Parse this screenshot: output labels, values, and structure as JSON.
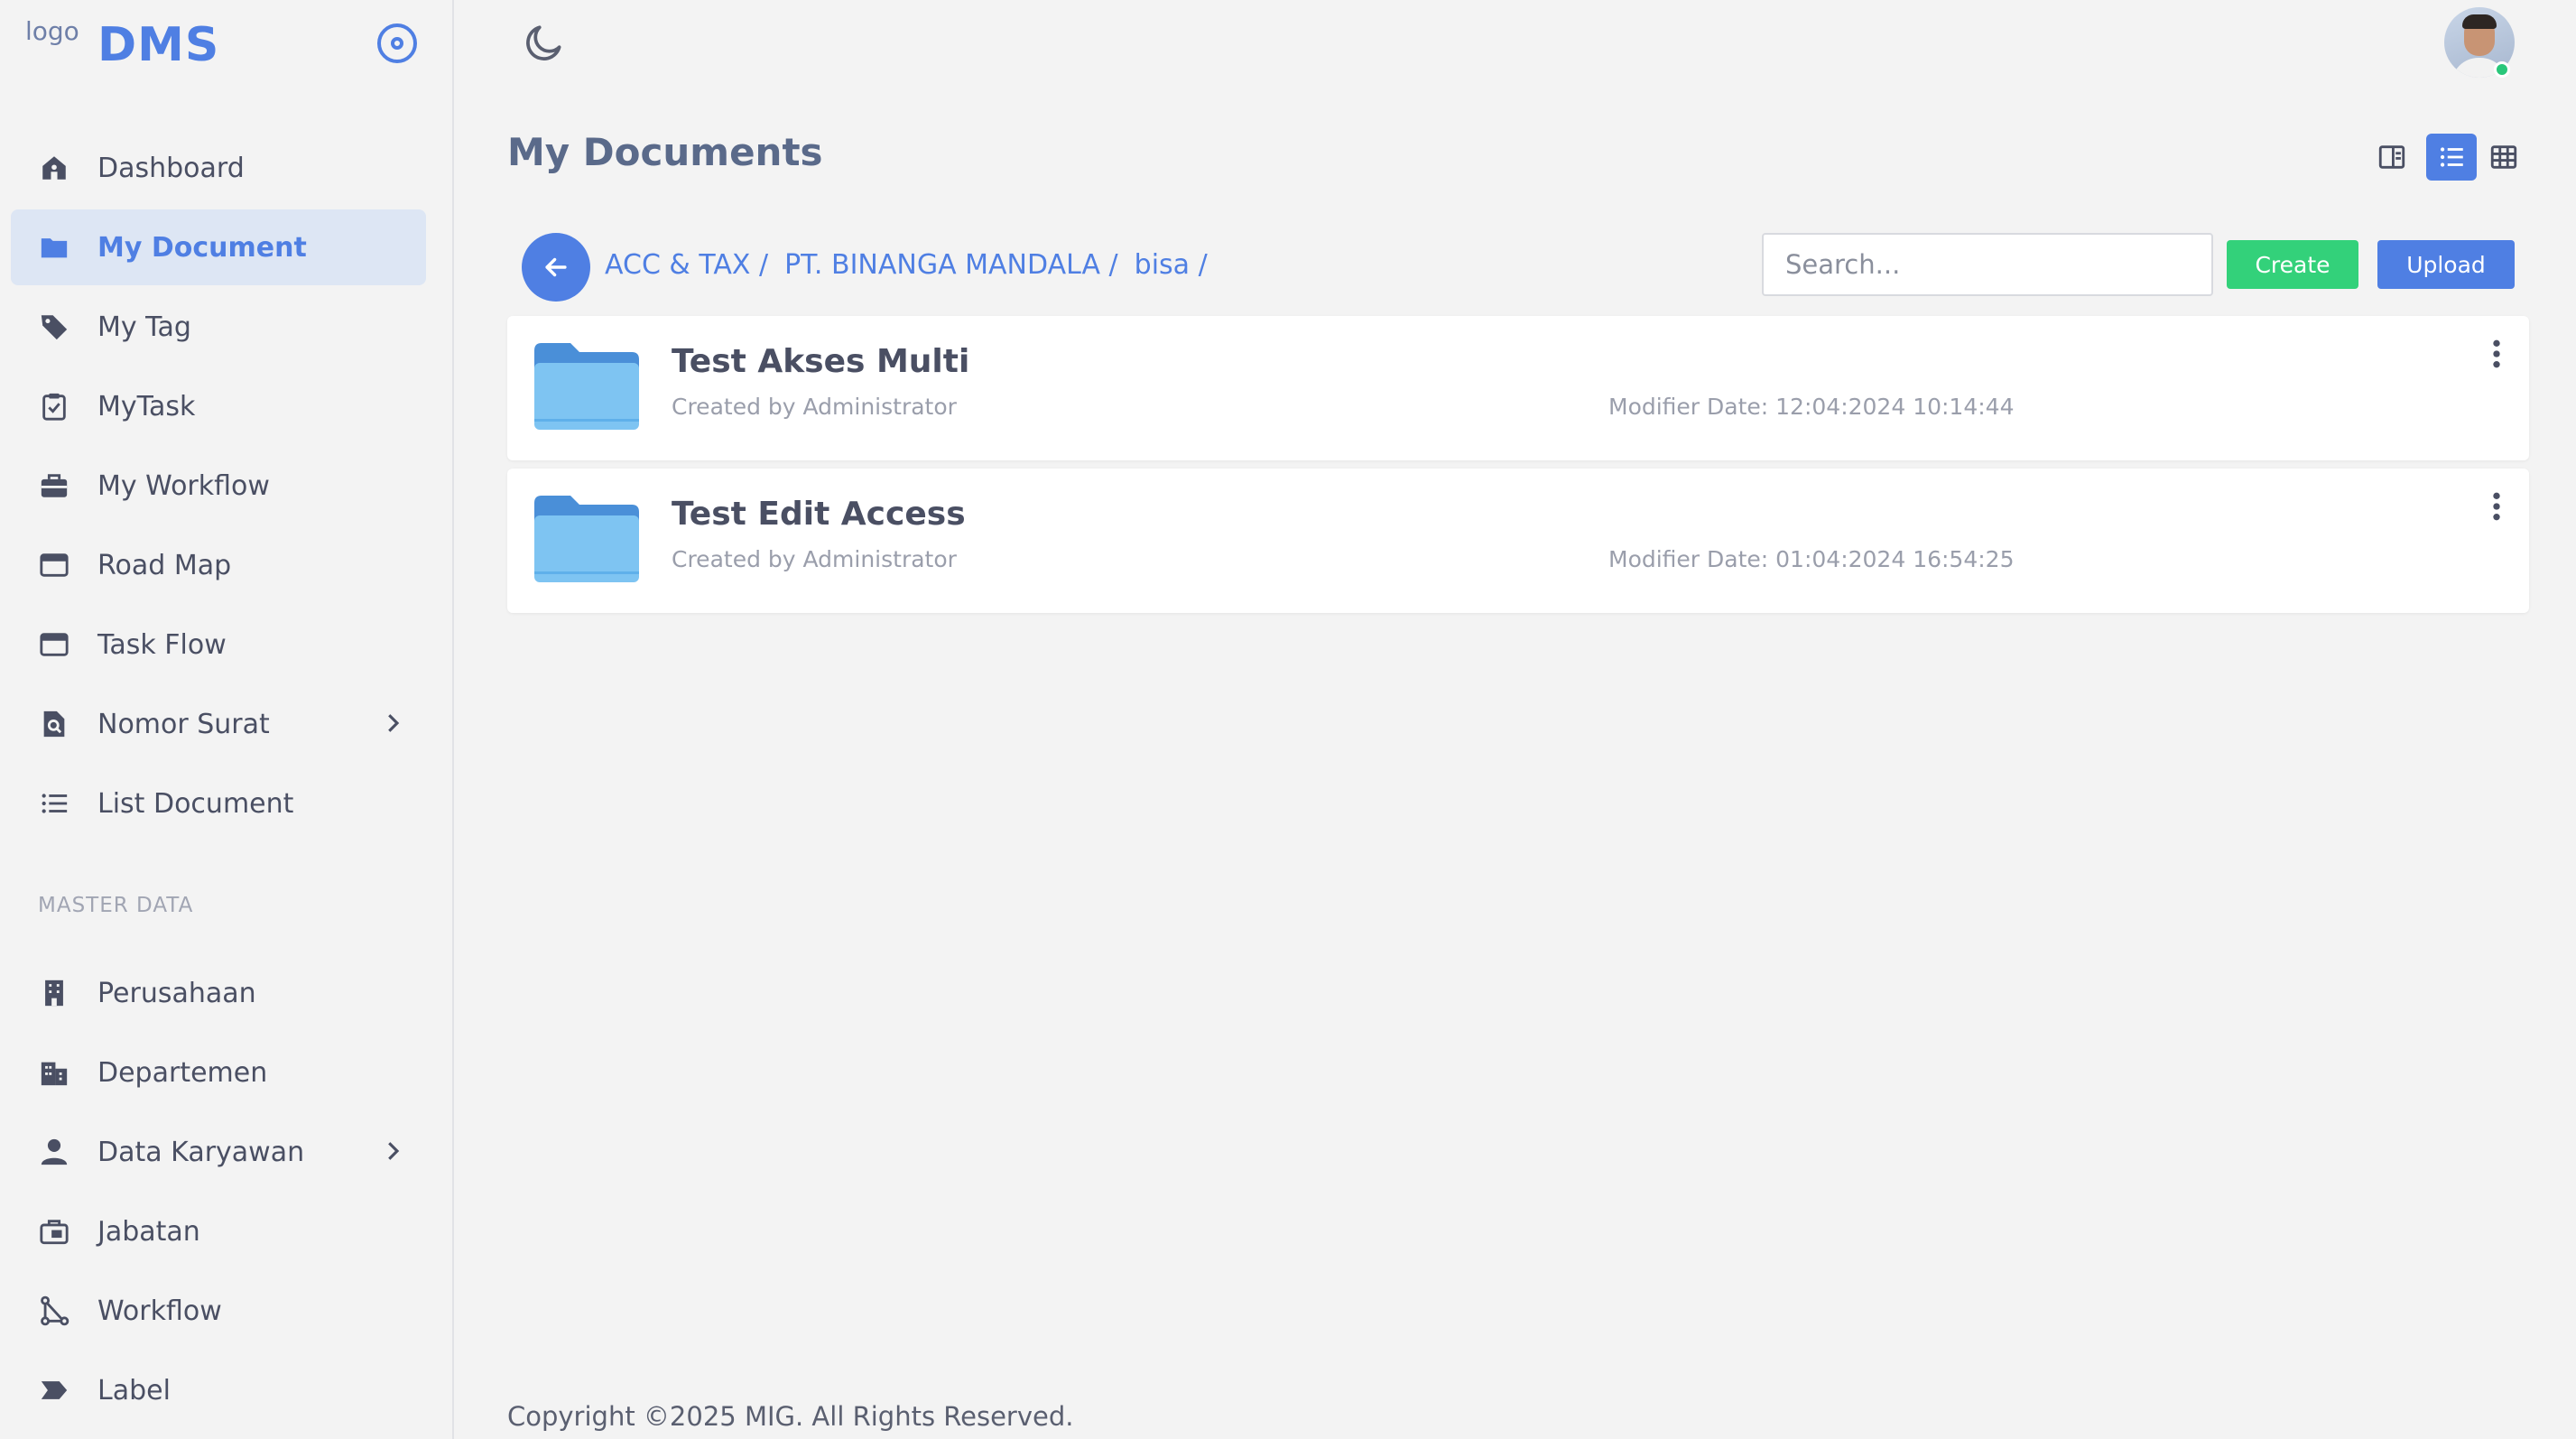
{
  "app": {
    "logo_alt": "logo",
    "brand": "DMS"
  },
  "sidebar": {
    "items": [
      {
        "label": "Dashboard",
        "icon": "home-icon",
        "active": false
      },
      {
        "label": "My Document",
        "icon": "folder-icon",
        "active": true
      },
      {
        "label": "My Tag",
        "icon": "tag-icon",
        "active": false
      },
      {
        "label": "MyTask",
        "icon": "clipboard-check-icon",
        "active": false
      },
      {
        "label": "My Workflow",
        "icon": "briefcase-icon",
        "active": false
      },
      {
        "label": "Road Map",
        "icon": "window-icon",
        "active": false
      },
      {
        "label": "Task Flow",
        "icon": "window-icon",
        "active": false
      },
      {
        "label": "Nomor Surat",
        "icon": "document-search-icon",
        "active": false,
        "has_children": true
      },
      {
        "label": "List Document",
        "icon": "list-icon",
        "active": false
      }
    ],
    "section_label": "MASTER DATA",
    "master_items": [
      {
        "label": "Perusahaan",
        "icon": "building-icon"
      },
      {
        "label": "Departemen",
        "icon": "buildings-icon"
      },
      {
        "label": "Data Karyawan",
        "icon": "person-icon",
        "has_children": true
      },
      {
        "label": "Jabatan",
        "icon": "briefcase-outline-icon"
      },
      {
        "label": "Workflow",
        "icon": "flow-icon"
      },
      {
        "label": "Label",
        "icon": "label-icon"
      }
    ]
  },
  "main": {
    "title": "My Documents",
    "breadcrumb": [
      "ACC & TAX /",
      "PT. BINANGA MANDALA /",
      "bisa /"
    ],
    "search_placeholder": "Search...",
    "create_label": "Create",
    "upload_label": "Upload",
    "active_view": "list",
    "documents": [
      {
        "name": "Test Akses Multi",
        "creator": "Created by Administrator",
        "modified": "Modifier Date: 12:04:2024 10:14:44"
      },
      {
        "name": "Test Edit Access",
        "creator": "Created by Administrator",
        "modified": "Modifier Date: 01:04:2024 16:54:25"
      }
    ]
  },
  "footer": {
    "text": "Copyright ©2025 MIG. All Rights Reserved."
  },
  "colors": {
    "accent": "#4f7fe3",
    "create": "#33d17a",
    "active_bg": "#dde6f4",
    "status_online": "#29c77a"
  }
}
